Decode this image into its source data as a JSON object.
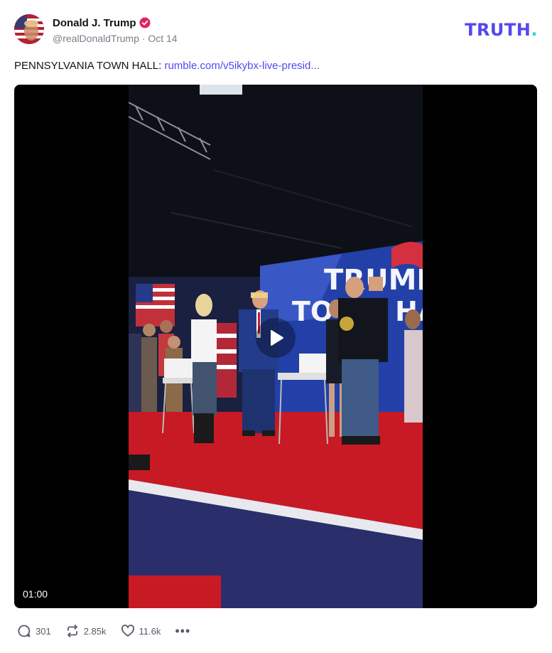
{
  "author": {
    "display_name": "Donald J. Trump",
    "handle": "@realDonaldTrump",
    "separator": "·",
    "date": "Oct 14",
    "verified_color": "#e0245e",
    "avatar_icon": "american-flag-portrait"
  },
  "brand": {
    "logo_text": "TRUTH",
    "logo_dot": ".",
    "logo_color": "#5448ee",
    "dot_color": "#2fd3c6"
  },
  "post": {
    "text_prefix": "PENNSYLVANIA TOWN HALL: ",
    "link_text": "rumble.com/v5ikybx-live-presid..."
  },
  "video": {
    "duration": "01:00",
    "play_icon": "play-icon"
  },
  "actions": {
    "replies": "301",
    "retruths": "2.85k",
    "likes": "11.6k",
    "more_label": "•••",
    "icons": [
      "comment-icon",
      "retruth-icon",
      "heart-icon",
      "more-icon"
    ]
  }
}
